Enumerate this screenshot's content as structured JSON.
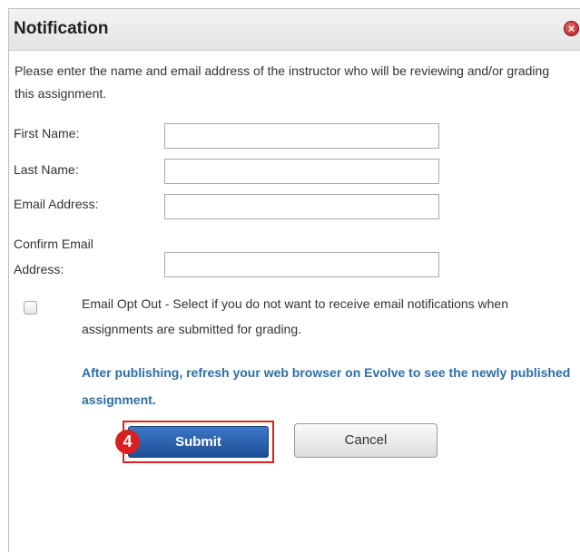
{
  "dialog": {
    "title": "Notification",
    "close_icon": "close-icon",
    "intro_text": "Please enter the name and email address of the instructor who will be reviewing and/or grading this assignment."
  },
  "form": {
    "first_name_label": "First Name:",
    "first_name_value": "",
    "last_name_label": "Last Name:",
    "last_name_value": "",
    "email_label": "Email Address:",
    "email_value": "",
    "confirm_email_label_line1": "Confirm Email",
    "confirm_email_label_line2": "Address:",
    "confirm_email_value": "",
    "opt_out_checked": false,
    "opt_out_text": "Email Opt Out - Select if you do not want to receive email notifications when assignments are submitted for grading.",
    "note_text": "After publishing, refresh your web browser on Evolve to see the newly published assignment."
  },
  "buttons": {
    "submit_label": "Submit",
    "cancel_label": "Cancel"
  },
  "annotation": {
    "step_number": "4",
    "highlight_color": "#e0201e"
  },
  "colors": {
    "submit_bg": "#2a5fa8",
    "note_text": "#2b6ea8"
  }
}
